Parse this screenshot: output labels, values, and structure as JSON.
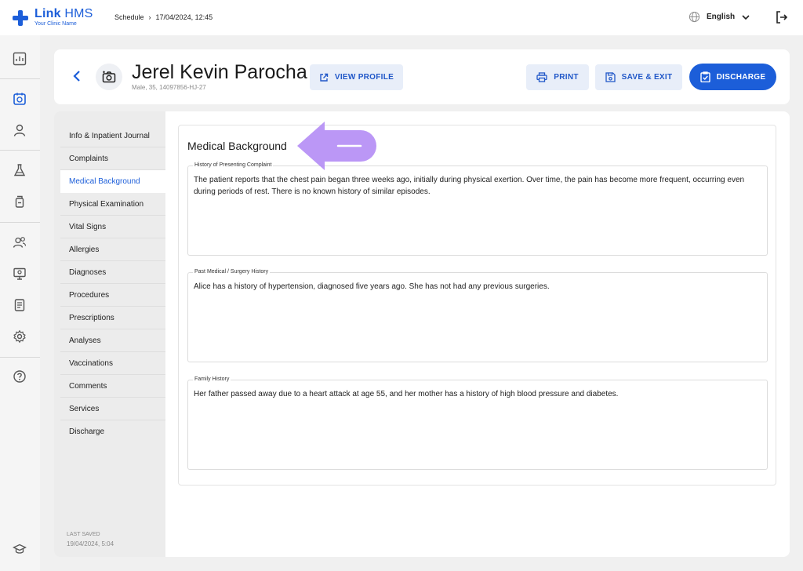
{
  "app": {
    "name_bold": "Link",
    "name_light": "HMS",
    "clinic": "Your Clinic Name"
  },
  "breadcrumb": {
    "section": "Schedule",
    "separator": "›",
    "datetime": "17/04/2024, 12:45"
  },
  "language": {
    "label": "English"
  },
  "patient": {
    "name": "Jerel Kevin Parocha",
    "meta": "Male, 35, 14097856-HJ-27"
  },
  "actions": {
    "view_profile": "VIEW PROFILE",
    "print": "PRINT",
    "save_exit": "SAVE & EXIT",
    "discharge": "DISCHARGE"
  },
  "nav": {
    "items": [
      "Info & Inpatient Journal",
      "Complaints",
      "Medical Background",
      "Physical Examination",
      "Vital Signs",
      "Allergies",
      "Diagnoses",
      "Procedures",
      "Prescriptions",
      "Analyses",
      "Vaccinations",
      "Comments",
      "Services",
      "Discharge"
    ],
    "active": "Medical Background",
    "last_saved_label": "LAST SAVED",
    "last_saved_value": "19/04/2024, 5:04"
  },
  "section": {
    "title": "Medical Background",
    "fields": [
      {
        "label": "History of Presenting Complaint",
        "value": "The patient reports that the chest pain began three weeks ago, initially during physical exertion. Over time, the pain has become more frequent, occurring even during periods of rest. There is no known history of similar episodes."
      },
      {
        "label": "Past Medical / Surgery History",
        "value": "Alice has a history of hypertension, diagnosed five years ago. She has not had any previous surgeries."
      },
      {
        "label": "Family History",
        "value": "Her father passed away due to a heart attack at age 55, and her mother has a history of high blood pressure and diabetes."
      }
    ]
  },
  "colors": {
    "brand": "#1c5ed9",
    "button_bg": "#e8eef9",
    "annotation_arrow": "#b48cf5"
  },
  "icons": {
    "rail": [
      "dashboard-icon",
      "schedule-icon",
      "patient-icon",
      "lab-icon",
      "pharmacy-icon",
      "staff-icon",
      "monitor-icon",
      "report-icon",
      "settings-icon",
      "help-icon",
      "academy-icon"
    ]
  }
}
